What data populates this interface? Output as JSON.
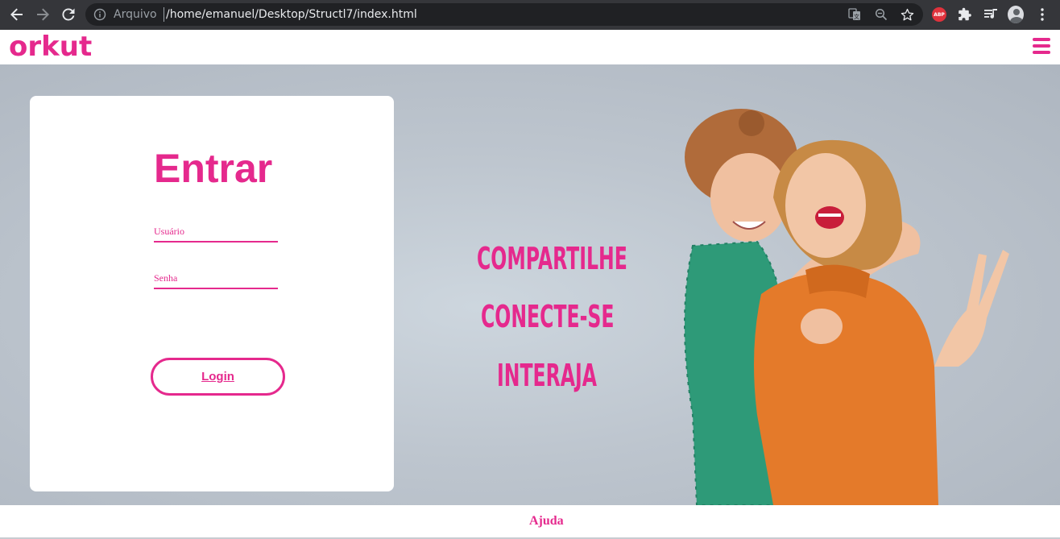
{
  "browser": {
    "scheme_label": "Arquivo",
    "url": "/home/emanuel/Desktop/Structl7/index.html",
    "extension_badge": "ABP"
  },
  "header": {
    "logo_text": "orkut"
  },
  "login": {
    "title": "Entrar",
    "username_placeholder": "Usuário",
    "password_placeholder": "Senha",
    "button_label": "Login"
  },
  "slogans": [
    "COMPARTILHE",
    "CONECTE-SE",
    "INTERAJA"
  ],
  "footer": {
    "help_label": "Ajuda"
  },
  "colors": {
    "brand": "#e5298d",
    "chrome_bg": "#35363a",
    "hero_bg": "#c3cbd4"
  }
}
